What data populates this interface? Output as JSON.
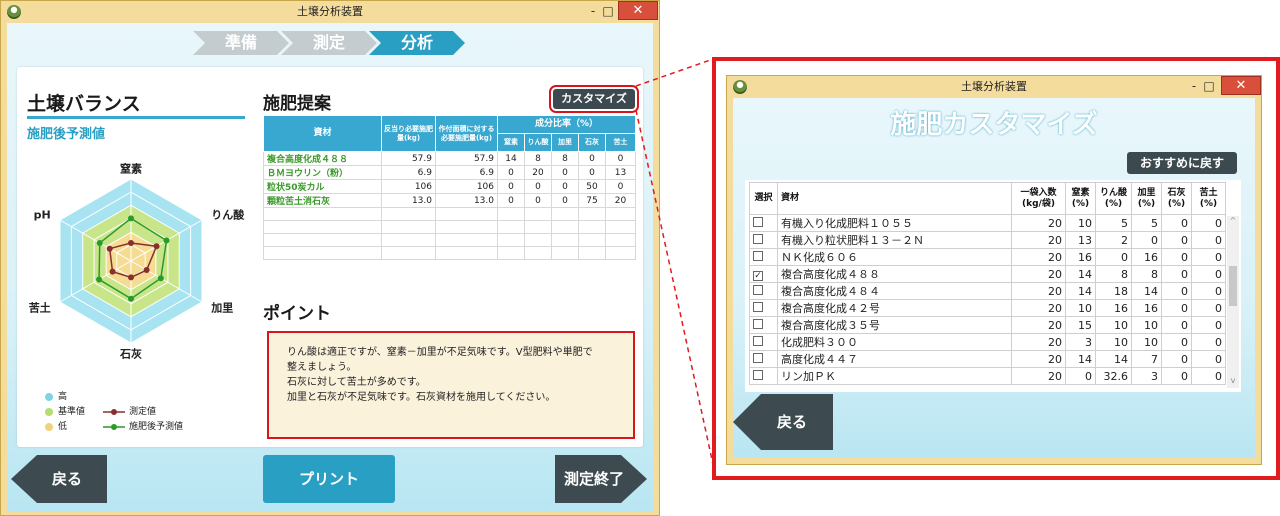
{
  "main_window": {
    "title": "土壌分析装置",
    "controls": {
      "minimize": "-",
      "maximize": "□",
      "close": "✕"
    },
    "steps": [
      {
        "label": "準備",
        "state": "done"
      },
      {
        "label": "測定",
        "state": "done"
      },
      {
        "label": "分析",
        "state": "active"
      }
    ],
    "soil_balance": {
      "title": "土壌バランス",
      "subtitle": "施肥後予測値",
      "legend": [
        {
          "label": "高",
          "color": "#7dd3e8"
        },
        {
          "label": "基準値",
          "color": "#b4dc6e"
        },
        {
          "label": "低",
          "color": "#f0d27a"
        },
        {
          "label": "測定値",
          "color": "#8a2e2e"
        },
        {
          "label": "施肥後予測値",
          "color": "#2a9a2a"
        }
      ]
    },
    "fertilizer": {
      "title": "施肥提案",
      "customize_label": "カスタマイズ",
      "headers": {
        "material": "資材",
        "per_area": "反当り必要施肥量(kg)",
        "field_area": "作付面積に対する必要施肥量(kg)",
        "ratio_group": "成分比率（%）",
        "components": [
          "窒素",
          "りん酸",
          "加里",
          "石灰",
          "苦土"
        ]
      },
      "rows": [
        {
          "name": "複合高度化成４８８",
          "per_area": "57.9",
          "field": "57.9",
          "values": [
            "14",
            "8",
            "8",
            "0",
            "0"
          ]
        },
        {
          "name": "ＢＭヨウリン（粉）",
          "per_area": "6.9",
          "field": "6.9",
          "values": [
            "0",
            "20",
            "0",
            "0",
            "13"
          ]
        },
        {
          "name": "粒状50炭カル",
          "per_area": "106",
          "field": "106",
          "values": [
            "0",
            "0",
            "0",
            "50",
            "0"
          ]
        },
        {
          "name": "顆粒苦土消石灰",
          "per_area": "13.0",
          "field": "13.0",
          "values": [
            "0",
            "0",
            "0",
            "75",
            "20"
          ]
        }
      ]
    },
    "point": {
      "title": "ポイント",
      "lines": [
        "りん酸は適正ですが、窒素－加里が不足気味です。V型肥料や単肥で",
        "整えましょう。",
        "石灰に対して苦土が多めです。",
        "加里と石灰が不足気味です。石灰資材を施用してください。"
      ]
    },
    "buttons": {
      "back": "戻る",
      "print": "プリント",
      "finish": "測定終了"
    }
  },
  "chart_data": {
    "type": "radar",
    "axes": [
      "窒素",
      "りん酸",
      "加里",
      "石灰",
      "苦土",
      "pH"
    ],
    "range": [
      0,
      1
    ],
    "bands": [
      {
        "name": "高",
        "value": 1.0
      },
      {
        "name": "基準値",
        "value": 0.68
      },
      {
        "name": "低",
        "value": 0.35
      }
    ],
    "series": [
      {
        "name": "測定値",
        "values": [
          0.22,
          0.36,
          0.22,
          0.2,
          0.26,
          0.3
        ]
      },
      {
        "name": "施肥後予測値",
        "values": [
          0.52,
          0.5,
          0.42,
          0.46,
          0.45,
          0.44
        ]
      }
    ]
  },
  "customize_window": {
    "title": "土壌分析装置",
    "heading": "施肥カスタマイズ",
    "recommend_label": "おすすめに戻す",
    "headers": {
      "select": "選択",
      "material": "資材",
      "bag": "一袋入数(kg/袋)",
      "components": [
        "窒素(%)",
        "りん酸(%)",
        "加里(%)",
        "石灰(%)",
        "苦土(%)"
      ]
    },
    "rows": [
      {
        "checked": false,
        "name": "有機入り化成肥料１０５５",
        "bag": "20",
        "values": [
          "10",
          "5",
          "5",
          "0",
          "0"
        ]
      },
      {
        "checked": false,
        "name": "有機入り粒状肥料１３－２Ｎ",
        "bag": "20",
        "values": [
          "13",
          "2",
          "0",
          "0",
          "0"
        ]
      },
      {
        "checked": false,
        "name": "ＮＫ化成６０６",
        "bag": "20",
        "values": [
          "16",
          "0",
          "16",
          "0",
          "0"
        ]
      },
      {
        "checked": true,
        "name": "複合高度化成４８８",
        "bag": "20",
        "values": [
          "14",
          "8",
          "8",
          "0",
          "0"
        ]
      },
      {
        "checked": false,
        "name": "複合高度化成４８４",
        "bag": "20",
        "values": [
          "14",
          "18",
          "14",
          "0",
          "0"
        ]
      },
      {
        "checked": false,
        "name": "複合高度化成４２号",
        "bag": "20",
        "values": [
          "10",
          "16",
          "16",
          "0",
          "0"
        ]
      },
      {
        "checked": false,
        "name": "複合高度化成３５号",
        "bag": "20",
        "values": [
          "15",
          "10",
          "10",
          "0",
          "0"
        ]
      },
      {
        "checked": false,
        "name": "化成肥料３００",
        "bag": "20",
        "values": [
          "3",
          "10",
          "10",
          "0",
          "0"
        ]
      },
      {
        "checked": false,
        "name": "高度化成４４７",
        "bag": "20",
        "values": [
          "14",
          "14",
          "7",
          "0",
          "0"
        ]
      },
      {
        "checked": false,
        "name": "リン加ＰＫ",
        "bag": "20",
        "values": [
          "0",
          "32.6",
          "3",
          "0",
          "0"
        ]
      }
    ],
    "back_label": "戻る"
  }
}
